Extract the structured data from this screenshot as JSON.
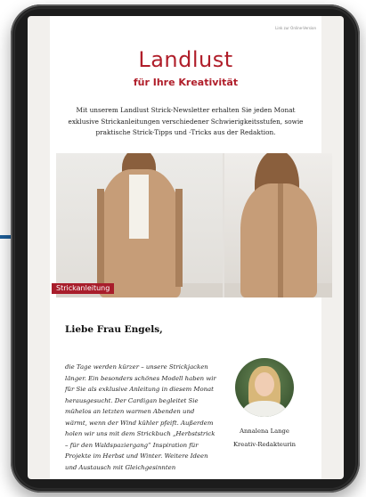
{
  "newsletter": {
    "online_link": "Link zur Online-Version",
    "logo_text": "Landlust",
    "tagline": "für Ihre Kreativität",
    "intro": "Mit unserem Landlust Strick-Newsletter erhalten Sie jeden Monat exklusive Strickanleitungen verschiedener Schwierigkeitsstufen, sowie praktische Strick-Tipps und -Tricks aus der Redaktion.",
    "hero_badge": "Strickanleitung",
    "greeting": "Liebe Frau Engels,",
    "body": "die Tage werden kürzer – unsere Strickjacken länger. Ein besonders schönes Modell haben wir für Sie als exklusive Anleitung in diesem Monat herausgesucht. Der Cardigan begleitet Sie mühelos an letzten warmen Abenden und wärmt, wenn der Wind kühler pfeift. Außerdem holen wir uns mit dem Strickbuch „Herbststrick – für den Waldspaziergang“ Inspiration für Projekte im Herbst und Winter. Weitere Ideen und Austausch mit Gleichgesinnten",
    "author_name": "Annalena Lange",
    "author_role": "Kreativ-Redakteurin"
  },
  "colors": {
    "brand_red": "#b01e2a",
    "badge_red": "#a81d2b",
    "side_accent": "#1f5f99"
  }
}
